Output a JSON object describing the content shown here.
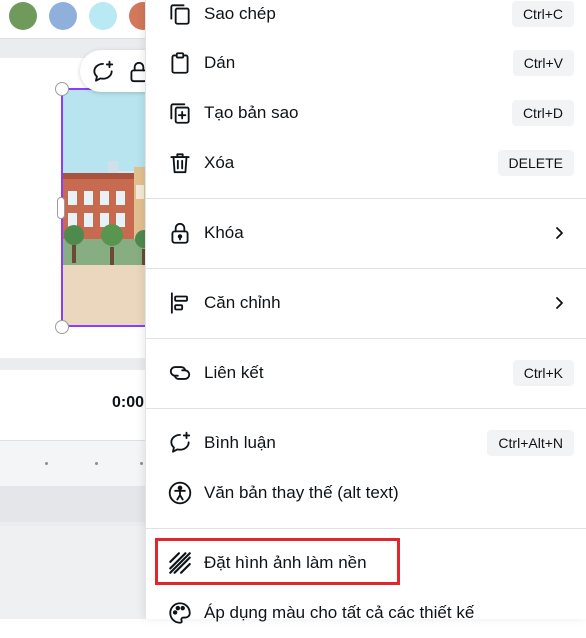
{
  "palette": {
    "swatches": [
      "#6f9a5c",
      "#8fb0da",
      "#b9eaf3",
      "#d3785a"
    ]
  },
  "timeline": {
    "time_label": "0:00"
  },
  "context_menu": {
    "items": [
      {
        "id": "copy",
        "label": "Sao chép",
        "shortcut": "Ctrl+C",
        "icon": "copy-icon"
      },
      {
        "id": "paste",
        "label": "Dán",
        "shortcut": "Ctrl+V",
        "icon": "clipboard-icon"
      },
      {
        "id": "duplicate",
        "label": "Tạo bản sao",
        "shortcut": "Ctrl+D",
        "icon": "duplicate-icon"
      },
      {
        "id": "delete",
        "label": "Xóa",
        "shortcut": "DELETE",
        "icon": "trash-icon"
      },
      {
        "id": "lock",
        "label": "Khóa",
        "submenu": true,
        "icon": "lock-icon"
      },
      {
        "id": "align",
        "label": "Căn chỉnh",
        "submenu": true,
        "icon": "align-icon"
      },
      {
        "id": "link",
        "label": "Liên kết",
        "shortcut": "Ctrl+K",
        "icon": "link-icon"
      },
      {
        "id": "comment",
        "label": "Bình luận",
        "shortcut": "Ctrl+Alt+N",
        "icon": "comment-add-icon"
      },
      {
        "id": "alt_text",
        "label": "Văn bản thay thế (alt text)",
        "icon": "accessibility-icon"
      },
      {
        "id": "set_background",
        "label": "Đặt hình ảnh làm nền",
        "icon": "background-hatch-icon",
        "highlighted": true
      },
      {
        "id": "apply_colors",
        "label": "Áp dụng màu cho tất cả các thiết kế",
        "icon": "palette-icon"
      }
    ]
  },
  "colors": {
    "selection": "#8b3dff",
    "highlight_box": "#e3262b",
    "shortcut_bg": "#f2f3f5"
  }
}
